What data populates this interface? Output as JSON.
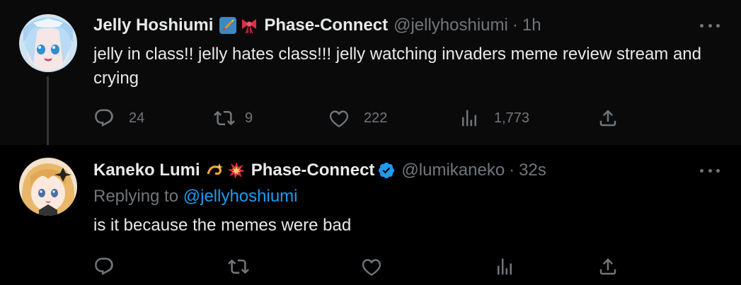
{
  "tweets": [
    {
      "author_name": "Jelly Hoshiumi",
      "emojis": [
        "rocket-emoji",
        "ribbon-emoji"
      ],
      "group": "Phase-Connect",
      "verified": false,
      "handle": "@jellyhoshiumi",
      "separator": "·",
      "time": "1h",
      "text": "jelly in class!! jelly hates class!!! jelly watching invaders meme review stream and crying",
      "replies": "24",
      "reposts": "9",
      "likes": "222",
      "views": "1,773"
    },
    {
      "author_name": "Kaneko Lumi",
      "emojis": [
        "dizzy-emoji",
        "collision-emoji"
      ],
      "group": "Phase-Connect",
      "verified": true,
      "handle": "@lumikaneko",
      "separator": "·",
      "time": "32s",
      "replying_prefix": "Replying to",
      "replying_handle": "@jellyhoshiumi",
      "text": "is it because the memes were bad",
      "replies": "",
      "reposts": "",
      "likes": "",
      "views": ""
    }
  ],
  "colors": {
    "text_primary": "#e7e9ea",
    "text_secondary": "#71767b",
    "link": "#1d9bf0",
    "verified": "#1d9bf0"
  }
}
